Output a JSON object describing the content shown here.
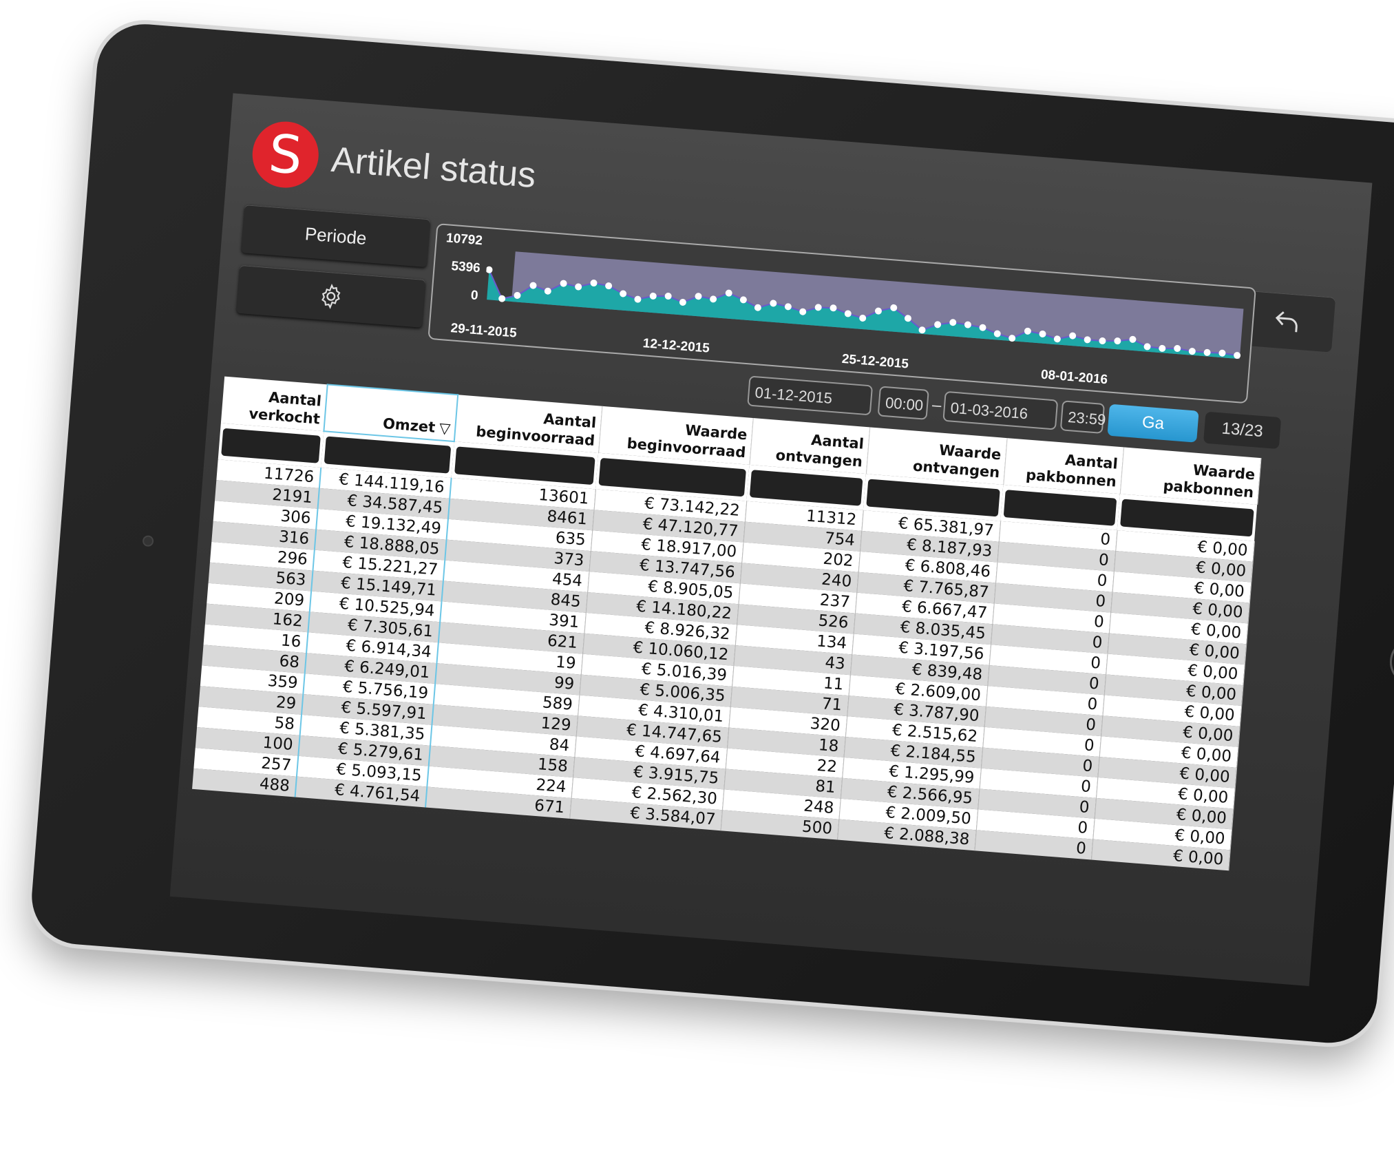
{
  "app": {
    "logo_letter": "S",
    "title": "Artikel status"
  },
  "sidebar": {
    "periode_label": "Periode",
    "settings_icon": "gear-icon"
  },
  "toolbar": {
    "icons": [
      "star-icon",
      "share-icon",
      "chevron-up-icon",
      "refresh-icon",
      "undo-icon"
    ]
  },
  "chart_data": {
    "type": "area",
    "y_ticks": [
      "10792",
      "5396",
      "0"
    ],
    "x_ticks": [
      "29-11-2015",
      "12-12-2015",
      "25-12-2015",
      "08-01-2016"
    ],
    "ylim": [
      0,
      10792
    ],
    "values": [
      5400,
      400,
      1200,
      3200,
      2400,
      4000,
      3600,
      4500,
      4200,
      3000,
      2200,
      3000,
      3200,
      2300,
      3600,
      3300,
      4600,
      3600,
      2400,
      3400,
      3000,
      2300,
      3300,
      3400,
      2600,
      2000,
      3500,
      4300,
      2600,
      700,
      1900,
      2500,
      2300,
      2000,
      1100,
      500,
      2000,
      1700,
      1000,
      1800,
      1300,
      1300,
      1500,
      2000,
      900,
      800,
      1000,
      700,
      700,
      800,
      600
    ],
    "colors": {
      "fill": "#1ea7a7",
      "line": "#6a5acd",
      "point": "#ffffff",
      "background_band": "#7d7a9a"
    }
  },
  "date_range": {
    "from_date": "01-12-2015",
    "from_time": "00:00",
    "separator": "–",
    "to_date": "01-03-2016",
    "to_time": "23:59"
  },
  "go_button": {
    "label": "Ga"
  },
  "page_counter": "13/23",
  "table": {
    "columns": [
      {
        "line1": "Aantal",
        "line2": "verkocht"
      },
      {
        "line1": "",
        "line2": "Omzet"
      },
      {
        "line1": "Aantal",
        "line2": "beginvoorraad"
      },
      {
        "line1": "Waarde",
        "line2": "beginvoorraad"
      },
      {
        "line1": "Aantal",
        "line2": "ontvangen"
      },
      {
        "line1": "Waarde",
        "line2": "ontvangen"
      },
      {
        "line1": "Aantal",
        "line2": "pakbonnen"
      },
      {
        "line1": "Waarde",
        "line2": "pakbonnen"
      }
    ],
    "sort_indicator": "▽",
    "rows": [
      [
        "11726",
        "€ 144.119,16",
        "13601",
        "€ 73.142,22",
        "11312",
        "€ 65.381,97",
        "0",
        "€ 0,00"
      ],
      [
        "2191",
        "€ 34.587,45",
        "8461",
        "€ 47.120,77",
        "754",
        "€ 8.187,93",
        "0",
        "€ 0,00"
      ],
      [
        "306",
        "€ 19.132,49",
        "635",
        "€ 18.917,00",
        "202",
        "€ 6.808,46",
        "0",
        "€ 0,00"
      ],
      [
        "316",
        "€ 18.888,05",
        "373",
        "€ 13.747,56",
        "240",
        "€ 7.765,87",
        "0",
        "€ 0,00"
      ],
      [
        "296",
        "€ 15.221,27",
        "454",
        "€ 8.905,05",
        "237",
        "€ 6.667,47",
        "0",
        "€ 0,00"
      ],
      [
        "563",
        "€ 15.149,71",
        "845",
        "€ 14.180,22",
        "526",
        "€ 8.035,45",
        "0",
        "€ 0,00"
      ],
      [
        "209",
        "€ 10.525,94",
        "391",
        "€ 8.926,32",
        "134",
        "€ 3.197,56",
        "0",
        "€ 0,00"
      ],
      [
        "162",
        "€ 7.305,61",
        "621",
        "€ 10.060,12",
        "43",
        "€ 839,48",
        "0",
        "€ 0,00"
      ],
      [
        "16",
        "€ 6.914,34",
        "19",
        "€ 5.016,39",
        "11",
        "€ 2.609,00",
        "0",
        "€ 0,00"
      ],
      [
        "68",
        "€ 6.249,01",
        "99",
        "€ 5.006,35",
        "71",
        "€ 3.787,90",
        "0",
        "€ 0,00"
      ],
      [
        "359",
        "€ 5.756,19",
        "589",
        "€ 4.310,01",
        "320",
        "€ 2.515,62",
        "0",
        "€ 0,00"
      ],
      [
        "29",
        "€ 5.597,91",
        "129",
        "€ 14.747,65",
        "18",
        "€ 2.184,55",
        "0",
        "€ 0,00"
      ],
      [
        "58",
        "€ 5.381,35",
        "84",
        "€ 4.697,64",
        "22",
        "€ 1.295,99",
        "0",
        "€ 0,00"
      ],
      [
        "100",
        "€ 5.279,61",
        "158",
        "€ 3.915,75",
        "81",
        "€ 2.566,95",
        "0",
        "€ 0,00"
      ],
      [
        "257",
        "€ 5.093,15",
        "224",
        "€ 2.562,30",
        "248",
        "€ 2.009,50",
        "0",
        "€ 0,00"
      ],
      [
        "488",
        "€ 4.761,54",
        "671",
        "€ 3.584,07",
        "500",
        "€ 2.088,38",
        "0",
        "€ 0,00"
      ]
    ]
  }
}
